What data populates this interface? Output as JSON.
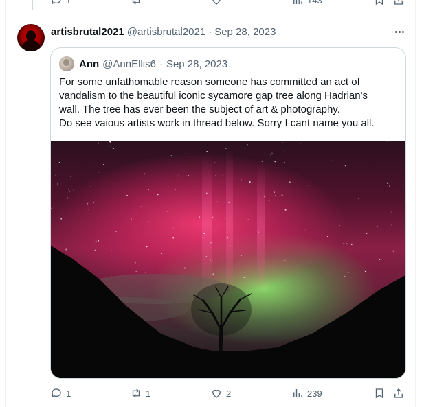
{
  "top_actions": {
    "reply_count": "1",
    "views_count": "143"
  },
  "post": {
    "author_name": "artisbrutal2021",
    "author_handle": "@artisbrutal2021",
    "separator": "·",
    "date": "Sep 28, 2023"
  },
  "quote": {
    "author_name": "Ann",
    "author_handle": "@AnnEllis6",
    "separator": "·",
    "date": "Sep 28, 2023",
    "text_lines": [
      "For some unfathomable reason someone has committed an act of",
      "vandalism to the beautiful iconic sycamore gap tree along Hadrian's",
      "wall.  The tree has ever been the subject of art & photography.",
      "Do see vaious artists work in thread below. Sorry I cant name you all."
    ]
  },
  "actions": {
    "reply_count": "1",
    "retweet_count": "1",
    "like_count": "2",
    "views_count": "239"
  },
  "icons": [
    "reply-icon",
    "retweet-icon",
    "like-icon",
    "views-icon",
    "bookmark-icon",
    "share-icon",
    "more-icon"
  ],
  "colors": {
    "muted_text": "#536471",
    "border": "#cfd9de",
    "text": "#0f1419"
  }
}
